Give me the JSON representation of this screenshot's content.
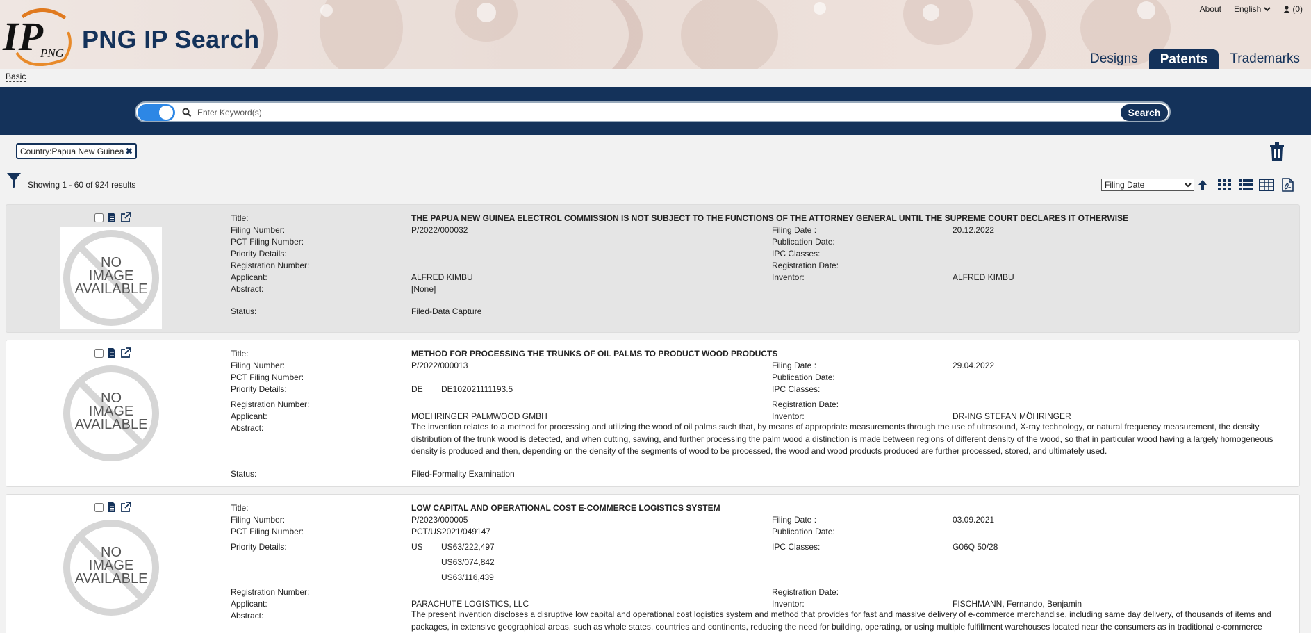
{
  "header": {
    "title": "PNG IP Search",
    "logo_text": "IP",
    "logo_sub": "PNG",
    "nav": {
      "about": "About",
      "language": "English",
      "cart": "(0)"
    },
    "tabs": [
      {
        "label": "Designs",
        "active": false
      },
      {
        "label": "Patents",
        "active": true
      },
      {
        "label": "Trademarks",
        "active": false
      }
    ]
  },
  "breadcrumb": "Basic",
  "search": {
    "placeholder": "Enter Keyword(s)",
    "button": "Search"
  },
  "filters": {
    "chip": "Country:Papua New Guinea",
    "remove": "✖"
  },
  "results": {
    "count_text": "Showing 1 - 60 of 924 results",
    "sort_selected": "Filing Date"
  },
  "labels": {
    "title": "Title:",
    "filing_number": "Filing Number:",
    "pct_filing_number": "PCT Filing Number:",
    "priority_details": "Priority Details:",
    "registration_number": "Registration Number:",
    "applicant": "Applicant:",
    "abstract": "Abstract:",
    "status": "Status:",
    "filing_date": "Filing Date :",
    "publication_date": "Publication Date:",
    "ipc_classes": "IPC Classes:",
    "registration_date": "Registration Date:",
    "inventor": "Inventor:",
    "no_image_1": "NO",
    "no_image_2": "IMAGE",
    "no_image_3": "AVAILABLE"
  },
  "records": [
    {
      "title": "THE PAPUA NEW GUINEA ELECTROL COMMISSION IS NOT SUBJECT TO THE FUNCTIONS OF THE ATTORNEY GENERAL UNTIL THE SUPREME COURT DECLARES IT OTHERWISE",
      "filing_number": "P/2022/000032",
      "filing_date": "20.12.2022",
      "applicant": "ALFRED KIMBU",
      "inventor": "ALFRED KIMBU",
      "abstract": "[None]",
      "status": "Filed-Data Capture"
    },
    {
      "title": "METHOD FOR PROCESSING THE TRUNKS OF OIL PALMS TO PRODUCT WOOD PRODUCTS",
      "filing_number": "P/2022/000013",
      "filing_date": "29.04.2022",
      "priority_country": "DE",
      "priority_number": "DE102021111193.5",
      "applicant": "MOEHRINGER PALMWOOD GMBH",
      "inventor": "DR-ING STEFAN MÖHRINGER",
      "abstract": "The invention relates to a method for processing and utilizing the wood of oil palms such that, by means of appropriate measurements through the use of ultrasound, X-ray technology, or natural frequency measurement, the density distribution of the trunk wood is detected, and when cutting, sawing, and further processing the palm wood a distinction is made between regions of different density of the wood, so that in particular wood having a largely homogeneous density is produced and then, depending on the density of the segments of wood to be processed, the wood and wood products produced are further processed, stored, and ultimately used.",
      "status": "Filed-Formality Examination"
    },
    {
      "title": "LOW CAPITAL AND OPERATIONAL COST E-COMMERCE LOGISTICS SYSTEM",
      "filing_number": "P/2023/000005",
      "filing_date": "03.09.2021",
      "pct_filing_number": "PCT/US2021/049147",
      "priority_country": "US",
      "priority_numbers": [
        "US63/222,497",
        "US63/074,842",
        "US63/116,439"
      ],
      "ipc_classes": "G06Q 50/28",
      "applicant": "PARACHUTE LOGISTICS, LLC",
      "inventor": "FISCHMANN, Fernando, Benjamin",
      "abstract": "The present invention discloses a disruptive low capital and operational cost logistics system and method that provides for fast and massive delivery of e-commerce merchandise, including same day delivery, of thousands of items and packages, in extensive geographical areas, such as whole states, countries and continents, reducing the need for building, operating, or using multiple fulfillment warehouses located near the consumers as in traditional e-commerce"
    }
  ],
  "colors": {
    "navy": "#14325a",
    "toggle_blue": "#2d87e5"
  }
}
